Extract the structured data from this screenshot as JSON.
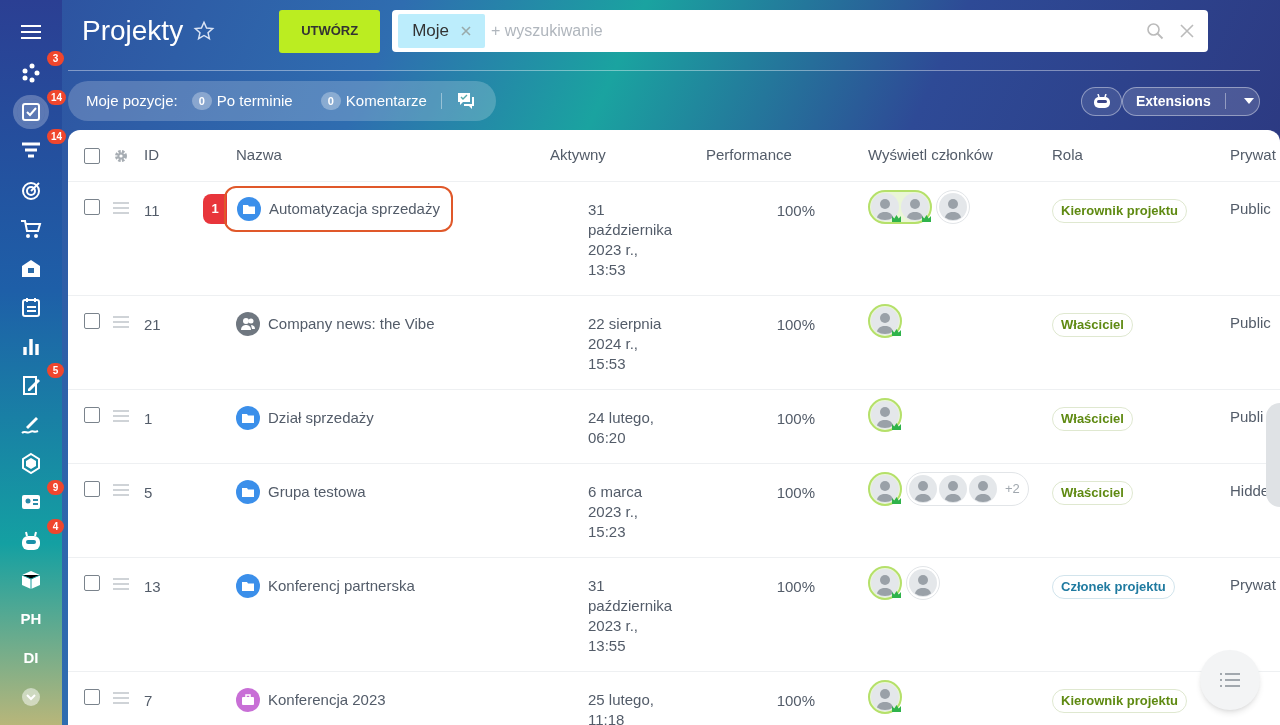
{
  "header": {
    "title": "Projekty",
    "create_button": "UTWÓRZ",
    "filter_chip": "Moje",
    "search": {
      "placeholder": "+ wyszukiwanie"
    }
  },
  "counters": {
    "label": "Moje pozycje:",
    "items": [
      {
        "count": "0",
        "label": "Po terminie"
      },
      {
        "count": "0",
        "label": "Komentarze"
      }
    ]
  },
  "extensions_button": "Extensions",
  "sidebar": {
    "items": [
      {
        "kind": "activity",
        "badge": "3",
        "selected": false
      },
      {
        "kind": "tasks",
        "badge": "14",
        "selected": true
      },
      {
        "kind": "funnel",
        "badge": "14",
        "selected": false
      },
      {
        "kind": "target",
        "selected": false
      },
      {
        "kind": "cart",
        "selected": false
      },
      {
        "kind": "store",
        "selected": false
      },
      {
        "kind": "calendar",
        "selected": false
      },
      {
        "kind": "chart",
        "selected": false
      },
      {
        "kind": "edit",
        "badge": "5",
        "selected": false
      },
      {
        "kind": "sign",
        "selected": false
      },
      {
        "kind": "hexagon",
        "selected": false
      },
      {
        "kind": "contact",
        "badge": "9",
        "selected": false
      },
      {
        "kind": "robot",
        "badge": "4",
        "selected": false
      },
      {
        "kind": "box",
        "selected": false
      },
      {
        "kind": "text",
        "label": "PH",
        "selected": false
      },
      {
        "kind": "text",
        "label": "DI",
        "selected": false
      },
      {
        "kind": "more",
        "selected": false
      }
    ]
  },
  "table": {
    "all_checked": false,
    "columns": [
      "ID",
      "Nazwa",
      "Aktywny",
      "Performance",
      "Wyświetl członków",
      "Rola",
      "Prywat"
    ],
    "rows": [
      {
        "checked": false,
        "id": "11",
        "kind": "folder",
        "name": "Automatyzacja sprzedaży",
        "highlighted": true,
        "callout": "1",
        "active": "31\npaździernika\n2023 r.,\n13:53",
        "performance": "100%",
        "members": [
          {
            "owner": true
          },
          {
            "owner": true
          },
          {
            "owner": false
          }
        ],
        "role": {
          "label": "Kierownik projektu",
          "color": "#5f8a12"
        },
        "privacy": "Public"
      },
      {
        "checked": false,
        "id": "21",
        "kind": "group",
        "name": "Company news: the Vibe",
        "highlighted": false,
        "active": "22 sierpnia\n2024 r.,\n15:53",
        "performance": "100%",
        "members": [
          {
            "owner": true
          }
        ],
        "role": {
          "label": "Właściciel",
          "color": "#5f8a12"
        },
        "privacy": "Public"
      },
      {
        "checked": false,
        "id": "1",
        "kind": "folder",
        "name": "Dział sprzedaży",
        "highlighted": false,
        "active": "24 lutego,\n06:20",
        "performance": "100%",
        "members": [
          {
            "owner": true
          }
        ],
        "role": {
          "label": "Właściciel",
          "color": "#5f8a12"
        },
        "privacy": "Publi"
      },
      {
        "checked": false,
        "id": "5",
        "kind": "folder",
        "name": "Grupa testowa",
        "highlighted": false,
        "active": "6 marca\n2023 r.,\n15:23",
        "performance": "100%",
        "members": [
          {
            "owner": true
          },
          {
            "owner": false
          },
          {
            "owner": false
          },
          {
            "owner": false
          }
        ],
        "more": "+2",
        "role": {
          "label": "Właściciel",
          "color": "#5f8a12"
        },
        "privacy": "Hidde"
      },
      {
        "checked": false,
        "id": "13",
        "kind": "folder",
        "name": "Konferencj partnerska",
        "highlighted": false,
        "active": "31\npaździernika\n2023 r.,\n13:55",
        "performance": "100%",
        "members": [
          {
            "owner": true
          },
          {
            "owner": false
          }
        ],
        "role": {
          "label": "Członek projektu",
          "color": "#1f7aa0"
        },
        "privacy": "Prywat"
      },
      {
        "checked": false,
        "id": "7",
        "kind": "briefcase",
        "name": "Konferencja 2023",
        "highlighted": false,
        "active": "25 lutego,\n11:18",
        "performance": "100%",
        "members": [
          {
            "owner": true
          }
        ],
        "role": {
          "label": "Kierownik projektu",
          "color": "#5f8a12"
        }
      }
    ]
  }
}
